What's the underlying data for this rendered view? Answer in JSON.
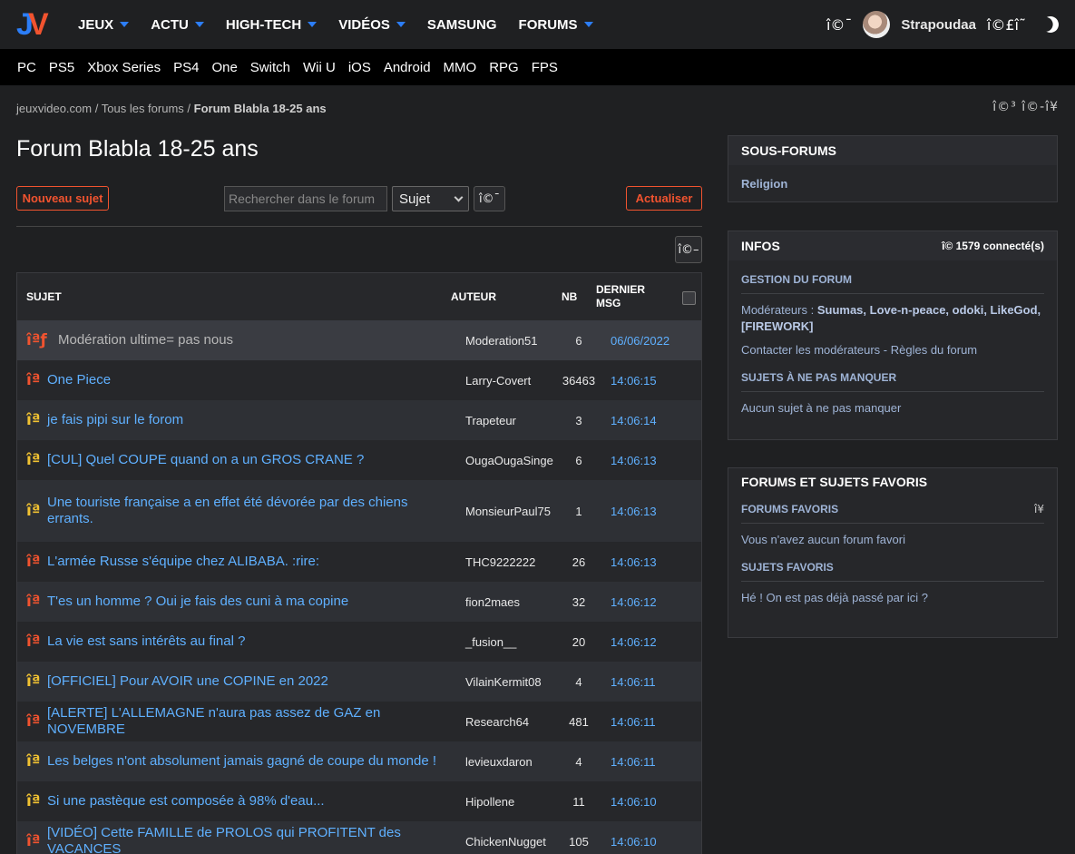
{
  "header": {
    "logo": "JV",
    "nav": [
      {
        "label": "JEUX",
        "dropdown": true
      },
      {
        "label": "ACTU",
        "dropdown": true
      },
      {
        "label": "HIGH-TECH",
        "dropdown": true
      },
      {
        "label": "VIDÉOS",
        "dropdown": true
      },
      {
        "label": "SAMSUNG",
        "dropdown": false
      },
      {
        "label": "FORUMS",
        "dropdown": true
      }
    ],
    "search_glyph": "î©¯",
    "username": "Strapoudaa",
    "user_glyphs": "î©£î˜",
    "accent": "#2c7ef8"
  },
  "subnav": [
    "PC",
    "PS5",
    "Xbox Series",
    "PS4",
    "One",
    "Switch",
    "Wii U",
    "iOS",
    "Android",
    "MMO",
    "RPG",
    "FPS"
  ],
  "breadcrumb": {
    "home": "jeuxvideo.com",
    "sep": "/",
    "forums": "Tous les forums",
    "current": "Forum Blabla 18-25 ans"
  },
  "crumb_glyphs": "î©³  î©-î¥",
  "page_title": "Forum Blabla 18-25 ans",
  "toolbar": {
    "new_topic": "Nouveau sujet",
    "search_placeholder": "Rechercher dans le forum",
    "select_value": "Sujet",
    "search_btn": "î©¯",
    "refresh": "Actualiser",
    "extra_btn": "î©–"
  },
  "table": {
    "headers": {
      "subject": "SUJET",
      "author": "AUTEUR",
      "nb": "NB",
      "last_line1": "DERNIER",
      "last_line2": "MSG"
    },
    "rows": [
      {
        "icon": "îªƒ",
        "color": "red",
        "subject": "Modération ultime= pas nous",
        "author": "Moderation51",
        "nb": "6",
        "last": "06/06/2022"
      },
      {
        "icon": "îª",
        "color": "red",
        "subject": "One Piece",
        "author": "Larry-Covert",
        "nb": "36463",
        "last": "14:06:15"
      },
      {
        "icon": "îª",
        "color": "yel",
        "subject": "je fais pipi sur le forom",
        "author": "Trapeteur",
        "nb": "3",
        "last": "14:06:14"
      },
      {
        "icon": "îª",
        "color": "yel",
        "subject": "[CUL] Quel COUPE quand on a un GROS CRANE ?",
        "author": "OugaOugaSinge",
        "nb": "6",
        "last": "14:06:13"
      },
      {
        "icon": "îª",
        "color": "yel",
        "subject": "Une touriste française a en effet été dévorée par des chiens errants.",
        "author": "MonsieurPaul75",
        "nb": "1",
        "last": "14:06:13"
      },
      {
        "icon": "îª",
        "color": "red",
        "subject": "L'armée Russe s'équipe chez ALIBABA. :rire:",
        "author": "THC9222222",
        "nb": "26",
        "last": "14:06:13"
      },
      {
        "icon": "îª",
        "color": "red",
        "subject": "T'es un homme ? Oui je fais des cuni à ma copine",
        "author": "fion2maes",
        "nb": "32",
        "last": "14:06:12"
      },
      {
        "icon": "îª",
        "color": "red",
        "subject": "La vie est sans intérêts au final ?",
        "author": "_fusion__",
        "nb": "20",
        "last": "14:06:12"
      },
      {
        "icon": "îª",
        "color": "yel",
        "subject": "[OFFICIEL] Pour AVOIR une COPINE en 2022",
        "author": "VilainKermit08",
        "nb": "4",
        "last": "14:06:11"
      },
      {
        "icon": "îª",
        "color": "red",
        "subject": "[ALERTE] L'ALLEMAGNE n'aura pas assez de GAZ en NOVEMBRE",
        "author": "Research64",
        "nb": "481",
        "last": "14:06:11"
      },
      {
        "icon": "îª",
        "color": "yel",
        "subject": "Les belges n'ont absolument jamais gagné de coupe du monde !",
        "author": "levieuxdaron",
        "nb": "4",
        "last": "14:06:11"
      },
      {
        "icon": "îª",
        "color": "yel",
        "subject": "Si une pastèque est composée à 98% d'eau...",
        "author": "Hipollene",
        "nb": "11",
        "last": "14:06:10"
      },
      {
        "icon": "îª",
        "color": "red",
        "subject": "[VIDÉO] Cette FAMILLE de PROLOS qui PROFITENT des VACANCES",
        "author": "ChickenNugget",
        "nb": "105",
        "last": "14:06:10"
      }
    ]
  },
  "sidebar": {
    "sous_forums": {
      "title": "SOUS-FORUMS",
      "items": [
        "Religion"
      ]
    },
    "infos": {
      "title": "INFOS",
      "connected": "î© 1579 connecté(s)",
      "gestion": "GESTION DU FORUM",
      "moderators_label": "Modérateurs :",
      "moderators": "Suumas, Love-n-peace, odoki, LikeGod, [FIREWORK]",
      "contact": "Contacter les modérateurs",
      "sep": " - ",
      "rules": "Règles du forum",
      "must_see": "SUJETS À NE PAS MANQUER",
      "must_see_text": "Aucun sujet à ne pas manquer"
    },
    "favorites": {
      "title": "FORUMS ET SUJETS FAVORIS",
      "forums_label": "FORUMS FAVORIS",
      "forums_glyph": "î¥",
      "forums_text": "Vous n'avez aucun forum favori",
      "topics_label": "SUJETS FAVORIS",
      "topics_text": "Hé ! On est pas déjà passé par ici ?"
    }
  }
}
